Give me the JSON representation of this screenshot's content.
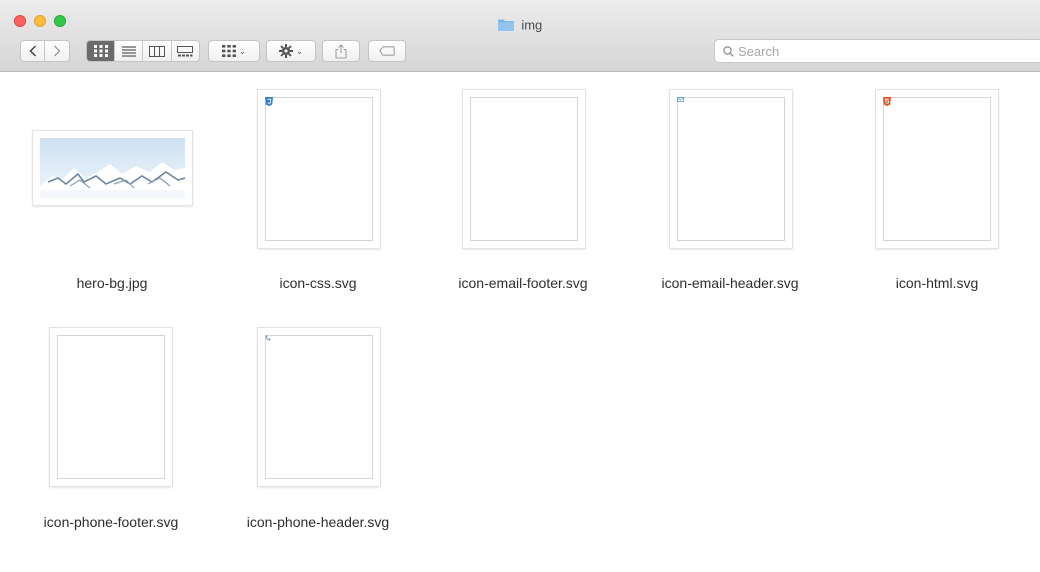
{
  "window": {
    "title": "img",
    "folder_color": "#7fb6e8"
  },
  "toolbar": {
    "nav": [
      "chevron-left-icon",
      "chevron-right-icon"
    ],
    "view_modes": [
      "icon-view-icon",
      "list-view-icon",
      "column-view-icon",
      "gallery-view-icon"
    ],
    "active_view": "icon-view-icon",
    "group_menu": "group-grid-icon",
    "action_menu": "gear-icon",
    "share": "share-icon",
    "tags": "tag-icon"
  },
  "search": {
    "placeholder": "Search",
    "value": ""
  },
  "files": [
    {
      "name": "hero-bg.jpg",
      "kind": "image"
    },
    {
      "name": "icon-css.svg",
      "kind": "svg",
      "badge": "css-shield",
      "badge_color": "#2f7fd1"
    },
    {
      "name": "icon-email-footer.svg",
      "kind": "svg"
    },
    {
      "name": "icon-email-header.svg",
      "kind": "svg",
      "badge": "envelope",
      "badge_color": "#5aa0e0"
    },
    {
      "name": "icon-html.svg",
      "kind": "svg",
      "badge": "html-shield",
      "badge_color": "#e5532d"
    },
    {
      "name": "icon-phone-footer.svg",
      "kind": "svg"
    },
    {
      "name": "icon-phone-header.svg",
      "kind": "svg",
      "badge": "phone",
      "badge_color": "#6aa8e0"
    }
  ],
  "colors": {
    "selection_dark": "#6b6b6b",
    "close": "#fc605c",
    "minimize": "#fdbc40",
    "zoom": "#34c84a"
  }
}
